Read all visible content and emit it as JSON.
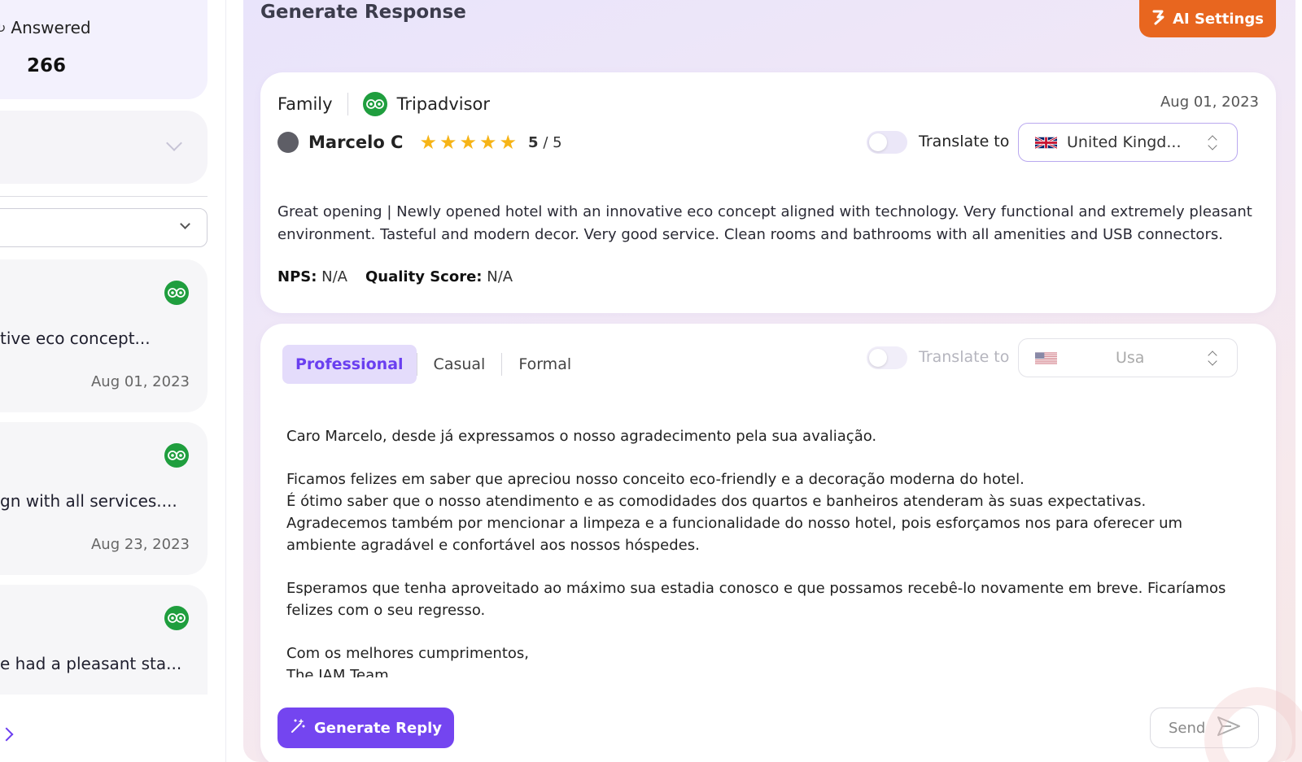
{
  "sidebar": {
    "answered_label": "Answered",
    "answered_count": "266",
    "reviews": [
      {
        "snippet": "tive eco concept...",
        "date": "Aug 01, 2023",
        "source_icon": "tripadvisor-icon"
      },
      {
        "snippet": "gn with all services....",
        "date": "Aug 23, 2023",
        "source_icon": "tripadvisor-icon"
      },
      {
        "snippet": "e had a pleasant sta...",
        "date": "",
        "source_icon": "tripadvisor-icon"
      }
    ]
  },
  "header": {
    "title": "Generate Response",
    "ai_settings_label": "AI Settings"
  },
  "review": {
    "category": "Family",
    "source": "Tripadvisor",
    "date": "Aug 01, 2023",
    "author": "Marcelo C",
    "stars": 5,
    "rating_value": "5",
    "rating_max": "/ 5",
    "translate_label": "Translate to",
    "translate_enabled": false,
    "translate_country": "United Kingd...",
    "text": "Great opening | Newly opened hotel with an innovative eco concept aligned with technology. Very functional and extremely pleasant environment. Tasteful and modern decor. Very good service. Clean rooms and bathrooms with all amenities and USB connectors.",
    "nps_label": "NPS:",
    "nps_value": "N/A",
    "quality_label": "Quality Score:",
    "quality_value": "N/A"
  },
  "reply": {
    "tabs": [
      "Professional",
      "Casual",
      "Formal"
    ],
    "active_tab": "Professional",
    "translate_label": "Translate to",
    "translate_enabled": false,
    "translate_country": "Usa",
    "paragraphs": [
      [
        "Caro Marcelo, desde já expressamos o nosso agradecimento pela sua avaliação."
      ],
      [
        "Ficamos felizes em saber que apreciou nosso conceito eco-friendly e a decoração moderna do hotel.",
        "É ótimo saber que o nosso atendimento e as comodidades dos quartos e banheiros atenderam às suas expectativas.",
        "Agradecemos também por mencionar a limpeza e a funcionalidade do nosso hotel, pois esforçamos nos para oferecer um ambiente agradável e confortável aos nossos hóspedes."
      ],
      [
        "Esperamos que tenha aproveitado ao máximo sua estadia conosco e que possamos recebê-lo novamente em breve. Ficaríamos felizes com o seu regresso."
      ],
      [
        "Com os melhores cumprimentos,",
        "The IAM Team"
      ]
    ],
    "generate_label": "Generate Reply",
    "send_label": "Send"
  },
  "colors": {
    "accent": "#7445f0",
    "ai_settings": "#e8661f",
    "star": "#f6b417",
    "tripadvisor": "#1f9e3e"
  }
}
